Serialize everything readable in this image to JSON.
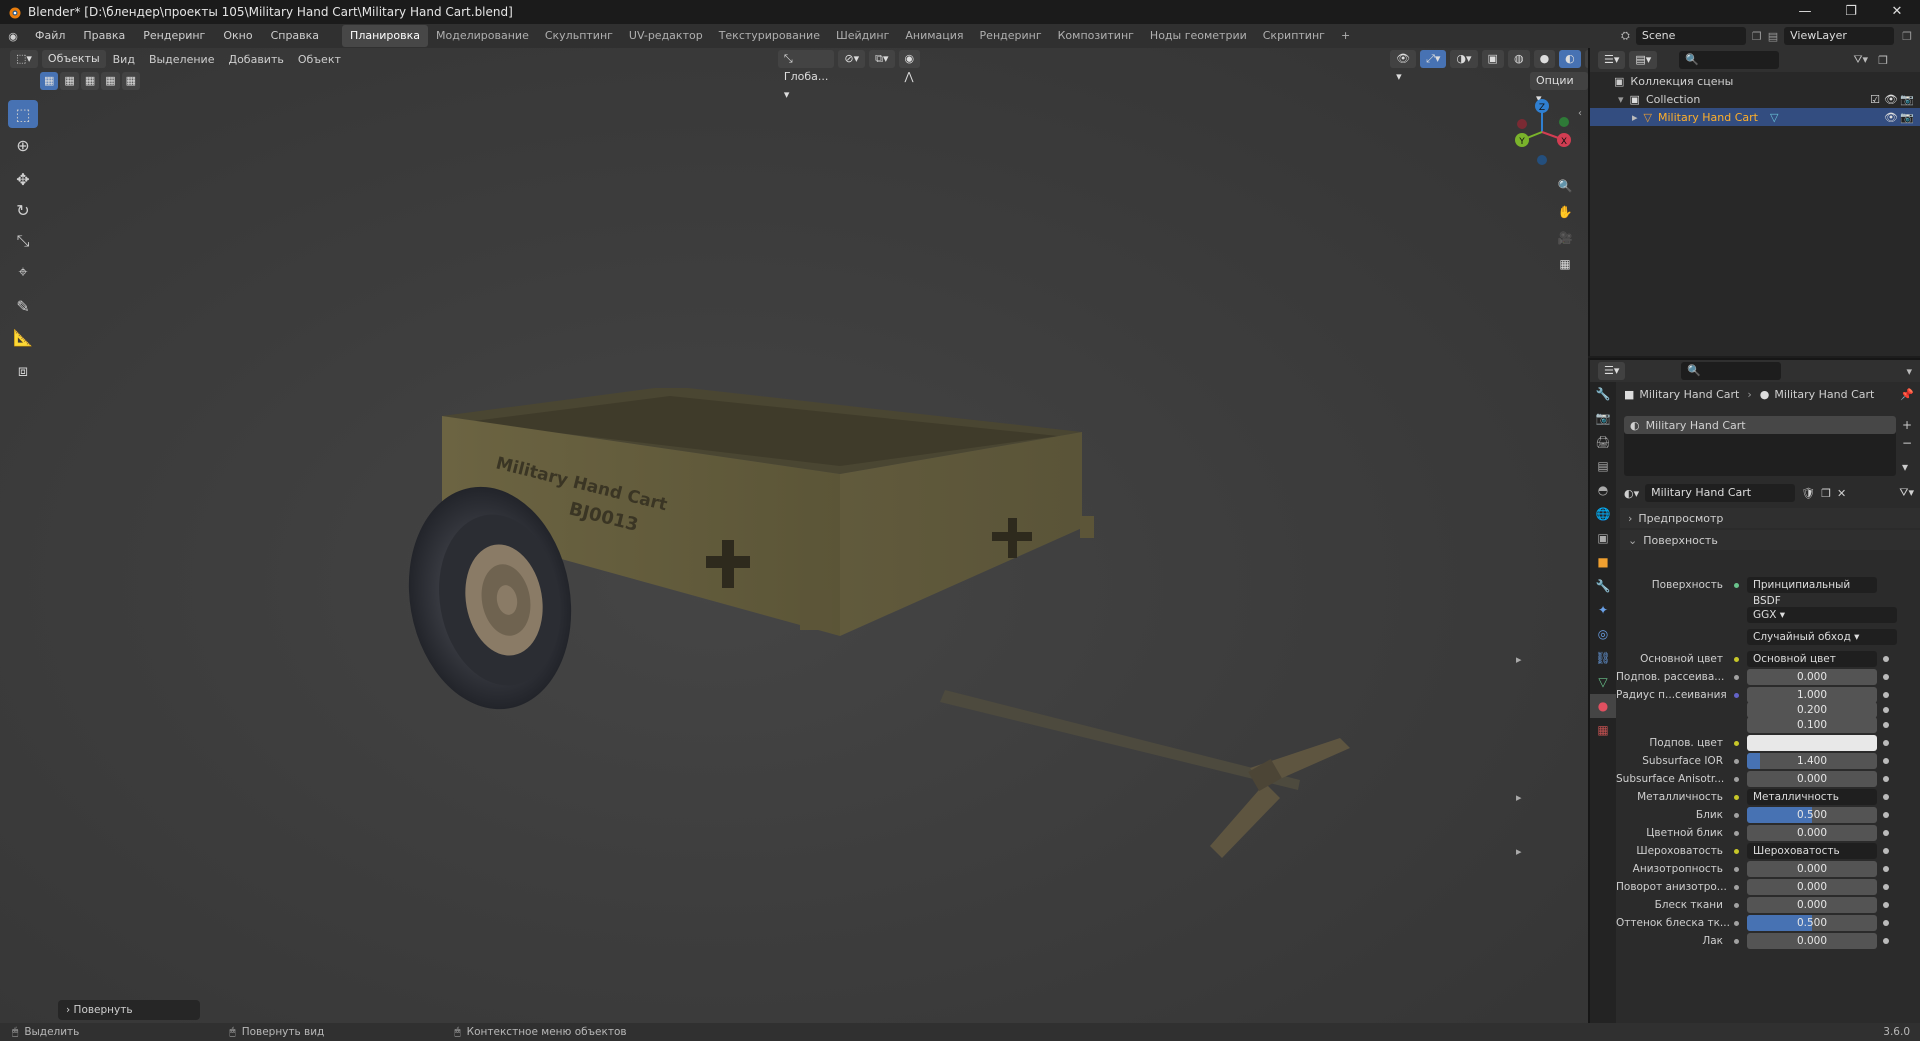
{
  "window": {
    "title": "Blender* [D:\\блендер\\проекты 105\\Military Hand Cart\\Military Hand Cart.blend]",
    "controls": [
      "—",
      "❐",
      "✕"
    ]
  },
  "menu": [
    "Файл",
    "Правка",
    "Рендеринг",
    "Окно",
    "Справка"
  ],
  "workspaces": [
    "Планировка",
    "Моделирование",
    "Скульптинг",
    "UV-редактор",
    "Текстурирование",
    "Шейдинг",
    "Анимация",
    "Рендеринг",
    "Композитинг",
    "Ноды геометрии",
    "Скриптинг"
  ],
  "active_workspace": "Планировка",
  "add_workspace": "+",
  "scene": {
    "name": "Scene",
    "view_layer": "ViewLayer"
  },
  "viewport_header": {
    "mode": "Объекты",
    "menu": [
      "Вид",
      "Выделение",
      "Добавить",
      "Объект"
    ],
    "transform_orientation": "Глоба...",
    "options": "Опции"
  },
  "viewport": {
    "cart_text_line1": "Military Hand Cart",
    "cart_text_line2": "BJ0013",
    "gizmo_axes": [
      "Z",
      "X",
      "Y"
    ],
    "last_operator": "Повернуть"
  },
  "outliner": {
    "root": "Коллекция сцены",
    "collection": "Collection",
    "object": "Military Hand Cart"
  },
  "properties": {
    "breadcrumb_object": "Military Hand Cart",
    "breadcrumb_material": "Military Hand Cart",
    "slot": "Military Hand Cart",
    "material_name": "Military Hand Cart",
    "panel_preview": "Предпросмотр",
    "panel_surface": "Поверхность",
    "surface_label": "Поверхность",
    "surface_shader": "Принципиальный BSDF",
    "distribution": "GGX",
    "subsurface_method": "Случайный обход",
    "rows": [
      {
        "label": "Основной цвет",
        "link": "Основной цвет"
      },
      {
        "label": "Подпов. рассеива...",
        "value": "0.000"
      },
      {
        "label": "Радиус п...сеивания",
        "value": "1.000"
      },
      {
        "label": "",
        "value": "0.200"
      },
      {
        "label": "",
        "value": "0.100"
      },
      {
        "label": "Подпов. цвет",
        "color": "#e8e8e8"
      },
      {
        "label": "Subsurface IOR",
        "value": "1.400",
        "fill": 0.1
      },
      {
        "label": "Subsurface Anisotr...",
        "value": "0.000"
      },
      {
        "label": "Металличность",
        "link": "Металличность"
      },
      {
        "label": "Блик",
        "value": "0.500",
        "fill": 0.5
      },
      {
        "label": "Цветной блик",
        "value": "0.000"
      },
      {
        "label": "Шероховатость",
        "link": "Шероховатость"
      },
      {
        "label": "Анизотропность",
        "value": "0.000"
      },
      {
        "label": "Поворот анизотро...",
        "value": "0.000"
      },
      {
        "label": "Блеск ткани",
        "value": "0.000"
      },
      {
        "label": "Оттенок блеска тк...",
        "value": "0.500",
        "fill": 0.5
      },
      {
        "label": "Лак",
        "value": "0.000"
      }
    ]
  },
  "status": {
    "select": "Выделить",
    "rotate_view": "Повернуть вид",
    "context_menu": "Контекстное меню объектов",
    "version": "3.6.0"
  },
  "colors": {
    "accent": "#4772b3",
    "bg": "#303030",
    "viewport": "#3d3d3d"
  }
}
